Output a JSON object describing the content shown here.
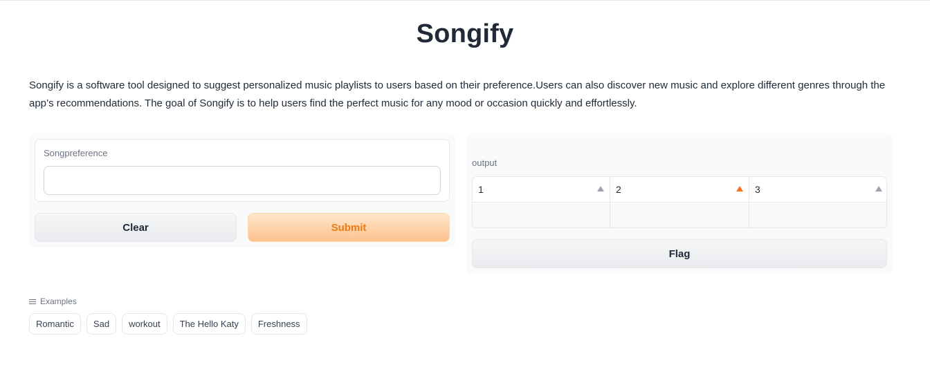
{
  "app": {
    "title": "Songify",
    "description": "Songify is a software tool designed to suggest personalized music playlists to users based on their preference.Users can also discover new music and explore different genres through the app’s recommendations. The goal of Songify is to help users find the perfect music for any mood or occasion quickly and effortlessly."
  },
  "input": {
    "label": "Songpreference",
    "value": "",
    "placeholder": ""
  },
  "buttons": {
    "clear": "Clear",
    "submit": "Submit",
    "flag": "Flag"
  },
  "output": {
    "label": "output",
    "columns": [
      "1",
      "2",
      "3"
    ],
    "rows": [
      [
        "",
        "",
        ""
      ]
    ],
    "sorted_column_index": 1
  },
  "examples": {
    "label": "Examples",
    "items": [
      "Romantic",
      "Sad",
      "workout",
      "The Hello Katy",
      "Freshness"
    ]
  },
  "colors": {
    "accent": "#f97316",
    "submit_text": "#ea7a16"
  },
  "icons": {
    "examples": "list-icon",
    "sort": "sort-arrow-icon"
  }
}
